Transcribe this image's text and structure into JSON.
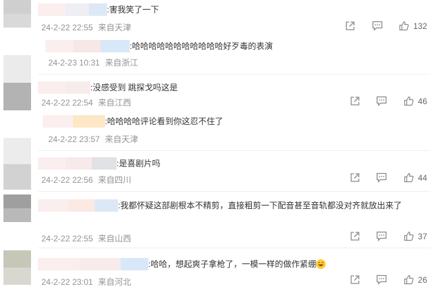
{
  "comments": [
    {
      "text": ":害我笑了一下",
      "time": "24-2-22 22:55",
      "loc": "来自天津",
      "likes": "132"
    },
    {
      "reply": true,
      "text": ":哈哈哈哈哈哈哈哈哈哈哈好歹毒的表演",
      "time": "24-2-23 10:31",
      "loc": "来自浙江"
    },
    {
      "text": ":没感受到 跳探戈吗这是",
      "time": "24-2-22 22:54",
      "loc": "来自江西",
      "likes": "46"
    },
    {
      "reply": true,
      "text": ":哈哈哈哈评论看到你这忍不住了",
      "time": "24-2-22 23:57",
      "loc": "来自天津"
    },
    {
      "text": ":是喜剧片吗",
      "time": "24-2-22 22:56",
      "loc": "来自四川",
      "likes": "44"
    },
    {
      "text": ":我都怀疑这部剧根本不精剪，直接粗剪一下配音甚至音轨都没对齐就放出来了",
      "time": "24-2-22 22:55",
      "loc": "来自山西",
      "likes": "37"
    },
    {
      "text": ":哈哈，想起爽子拿枪了，一模一样的做作紧绷",
      "time": "24-2-22 23:01",
      "loc": "来自河北",
      "likes": "26"
    }
  ],
  "icons": {
    "share": "share-icon",
    "comment": "comment-icon",
    "like": "thumbs-up-icon",
    "emoji": "grinning-emoji-icon"
  },
  "colors": {
    "meta_text": "#939393",
    "icon": "#8a8a8a"
  }
}
